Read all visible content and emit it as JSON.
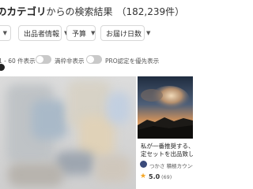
{
  "header": {
    "category_label": "のカテゴリ",
    "category_suffix": "からの検索結果",
    "result_count": "（182,239件）"
  },
  "filters": [
    {
      "label": "出品者情報"
    },
    {
      "label": "予算"
    },
    {
      "label": "お届け日数"
    }
  ],
  "results": {
    "range_text": "1 - 60 件表示",
    "toggle_hide_label": "満枠非表示",
    "toggle_pro_label": "PRO認定を優先表示"
  },
  "card": {
    "title_line1": "私が一番推奨する、フ",
    "title_line2": "定セットを出品致しま",
    "seller": "つかさ 積極カウンセ",
    "rating": "5.0",
    "reviews": "(69)"
  },
  "colors": {
    "star": "#f5a623",
    "toggle_off": "#c9c9c9"
  },
  "icons": [
    "chevron-down-icon",
    "star-icon",
    "avatar"
  ]
}
